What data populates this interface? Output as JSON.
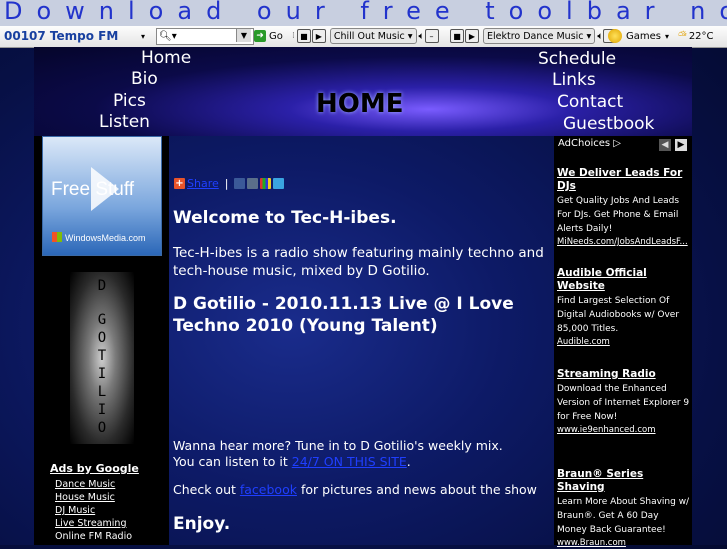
{
  "banner": {
    "text": "Download our free toolbar now"
  },
  "toolbar": {
    "station": "00107 Tempo FM",
    "go_label": "Go",
    "channel1": "Chill Out Music",
    "channel2": "Elektro Dance Music",
    "games_label": "Games",
    "weather": "22°C"
  },
  "header": {
    "title": "HOME",
    "nav_left": [
      "Home",
      "Bio",
      "Pics",
      "Listen"
    ],
    "nav_right": [
      "Schedule",
      "Links",
      "Contact",
      "Guestbook"
    ]
  },
  "left": {
    "freestuff_label": "Free Stuff",
    "windowsmedia_label": "WindowsMedia.com",
    "gotilio_letters": [
      "D",
      "G",
      "O",
      "T",
      "I",
      "L",
      "I",
      "O"
    ],
    "ads_title": "Ads by Google",
    "ad_links": [
      "Dance Music",
      "House Music",
      "DJ Music",
      "Live Streaming",
      "Online FM Radio"
    ]
  },
  "main": {
    "share_label": "Share",
    "welcome": "Welcome to Tec-H-ibes.",
    "intro": "Tec-H-ibes is a radio show featuring mainly techno and tech-house music, mixed by D Gotilio.",
    "post_title": "D Gotilio - 2010.11.13 Live @ I Love Techno 2010 (Young Talent)",
    "more_line1": "Wanna hear more? Tune in to D Gotilio's weekly mix.",
    "more_line2_prefix": "You can listen to it ",
    "more_line2_link": "24/7 ON THIS SITE",
    "more_line2_suffix": ".",
    "checkout_prefix": "Check out ",
    "checkout_link": "facebook",
    "checkout_suffix": " for pictures and news about the show",
    "enjoy": "Enjoy."
  },
  "right": {
    "adchoices": "AdChoices ▷",
    "ads": [
      {
        "title": "We Deliver Leads For DJs",
        "body": "Get Quality Jobs And Leads For DJs. Get Phone & Email Alerts Daily!",
        "url": "MiNeeds.com/JobsAndLeadsF..."
      },
      {
        "title": "Audible Official Website",
        "body": "Find Largest Selection Of Digital Audiobooks w/ Over 85,000 Titles.",
        "url": "Audible.com"
      },
      {
        "title": "Streaming Radio",
        "body": "Download the Enhanced Version of Internet Explorer 9 for Free Now!",
        "url": "www.ie9enhanced.com"
      },
      {
        "title": "Braun® Series Shaving",
        "body": "Learn More About Shaving w/ Braun®. Get A 60 Day Money Back Guarantee!",
        "url": "www.Braun.com"
      }
    ]
  }
}
